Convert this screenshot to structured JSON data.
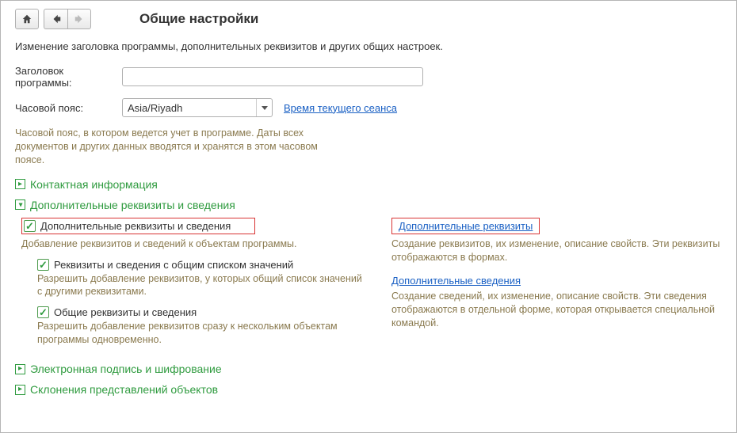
{
  "header": {
    "title": "Общие настройки"
  },
  "description": "Изменение заголовка программы, дополнительных реквизитов и других общих настроек.",
  "form": {
    "programTitleLabel": "Заголовок программы:",
    "programTitleValue": "",
    "timezoneLabel": "Часовой пояс:",
    "timezoneValue": "Asia/Riyadh",
    "sessionTimeLink": "Время текущего сеанса",
    "timezoneHint": "Часовой пояс, в котором ведется учет в программе. Даты всех документов и других данных вводятся и хранятся в этом часовом поясе."
  },
  "sections": {
    "contact": "Контактная информация",
    "extraAttrs": {
      "title": "Дополнительные реквизиты и сведения",
      "mainCheckboxLabel": "Дополнительные реквизиты и сведения",
      "mainHint": "Добавление реквизитов и сведений к объектам программы.",
      "sharedListLabel": "Реквизиты и сведения с общим списком значений",
      "sharedListHint": "Разрешить добавление реквизитов, у которых общий список значений с другими реквизитами.",
      "commonAttrsLabel": "Общие реквизиты и сведения",
      "commonAttrsHint": "Разрешить добавление реквизитов сразу к нескольким объектам программы одновременно.",
      "extraReqLink": "Дополнительные реквизиты",
      "extraReqHint": "Создание реквизитов, их изменение, описание свойств. Эти реквизиты отображаются в формах.",
      "extraInfoLink": "Дополнительные сведения",
      "extraInfoHint": "Создание сведений, их изменение, описание свойств. Эти сведения отображаются в отдельной форме, которая открывается специальной командой."
    },
    "signature": "Электронная подпись и шифрование",
    "declensions": "Склонения представлений объектов"
  }
}
